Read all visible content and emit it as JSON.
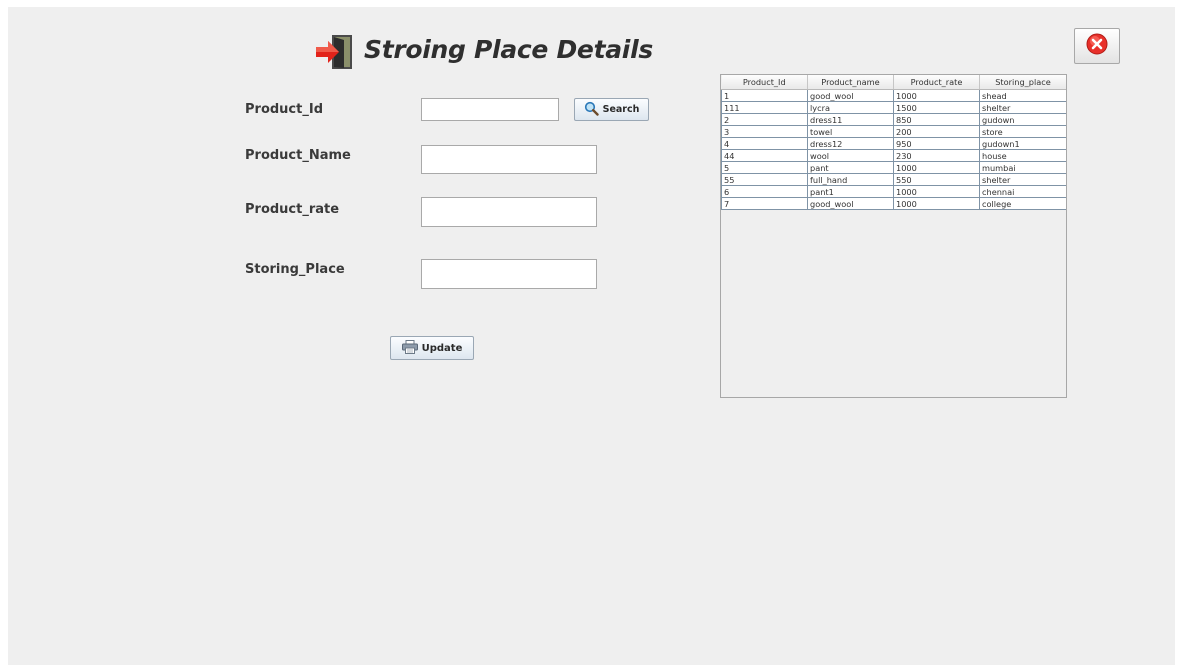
{
  "header": {
    "title": "Stroing Place Details",
    "icon": "exit-door-icon"
  },
  "close_button": {
    "icon": "close-icon",
    "color": "#e53935"
  },
  "form": {
    "product_id_label": "Product_Id",
    "product_name_label": "Product_Name",
    "product_rate_label": "Product_rate",
    "storing_place_label": "Storing_Place",
    "product_id_value": "",
    "product_name_value": "",
    "product_rate_value": "",
    "storing_place_value": "",
    "search_label": "Search",
    "search_icon": "search-icon",
    "update_label": "Update",
    "update_icon": "printer-icon"
  },
  "table": {
    "columns": [
      "Product_Id",
      "Product_name",
      "Product_rate",
      "Storing_place"
    ],
    "rows": [
      [
        "1",
        "good_wool",
        "1000",
        "shead"
      ],
      [
        "111",
        "lycra",
        "1500",
        "shelter"
      ],
      [
        "2",
        "dress11",
        "850",
        "gudown"
      ],
      [
        "3",
        "towel",
        "200",
        "store"
      ],
      [
        "4",
        "dress12",
        "950",
        "gudown1"
      ],
      [
        "44",
        "wool",
        "230",
        "house"
      ],
      [
        "5",
        "pant",
        "1000",
        "mumbai"
      ],
      [
        "55",
        "full_hand",
        "550",
        "shelter"
      ],
      [
        "6",
        "pant1",
        "1000",
        "chennai"
      ],
      [
        "7",
        "good_wool",
        "1000",
        "college"
      ]
    ]
  }
}
